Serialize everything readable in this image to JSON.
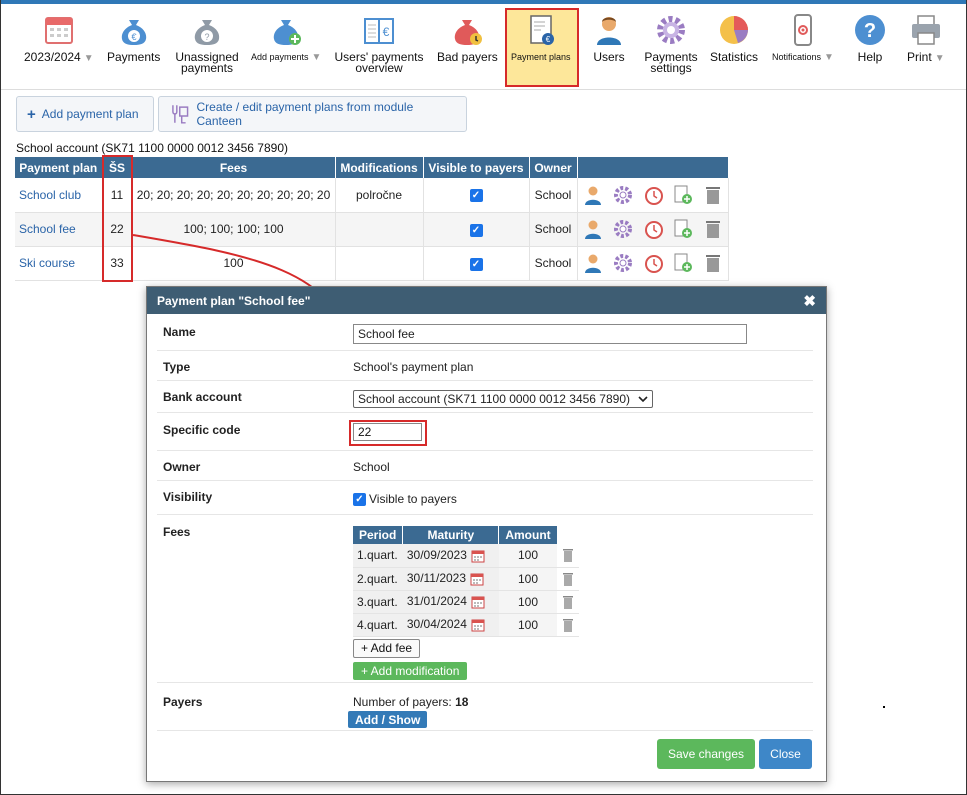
{
  "toolbar": {
    "items": [
      {
        "label": "2023/2024",
        "icon": "calendar-icon",
        "has_dropdown": true
      },
      {
        "label": "Payments",
        "icon": "money-bag-icon",
        "has_dropdown": false
      },
      {
        "label": "Unassigned payments",
        "icon": "unassigned-bag-icon",
        "has_dropdown": false
      },
      {
        "label": "Add payments",
        "icon": "add-payments-icon",
        "has_dropdown": true
      },
      {
        "label": "Users' payments overview",
        "icon": "ledger-icon",
        "has_dropdown": false
      },
      {
        "label": "Bad payers",
        "icon": "bad-payers-icon",
        "has_dropdown": false
      },
      {
        "label": "Payment plans",
        "icon": "payment-plan-document-icon",
        "has_dropdown": false,
        "active": true
      },
      {
        "label": "Users",
        "icon": "user-icon",
        "has_dropdown": false
      },
      {
        "label": "Payments settings",
        "icon": "gear-icon",
        "has_dropdown": false
      },
      {
        "label": "Statistics",
        "icon": "pie-chart-icon",
        "has_dropdown": false
      },
      {
        "label": "Notifications",
        "icon": "phone-icon",
        "has_dropdown": true
      },
      {
        "label": "Help",
        "icon": "help-icon",
        "has_dropdown": false
      },
      {
        "label": "Print",
        "icon": "printer-icon",
        "has_dropdown": true
      }
    ]
  },
  "actions": {
    "add_plan": "Add payment plan",
    "canteen": "Create / edit payment plans from module Canteen"
  },
  "account_label": "School account (SK71 1100 0000 0012 3456 7890)",
  "table": {
    "headers": [
      "Payment plan",
      "ŠS",
      "Fees",
      "Modifications",
      "Visible to payers",
      "Owner"
    ],
    "rows": [
      {
        "name": "School club",
        "ss": "11",
        "fees": "20; 20; 20; 20; 20; 20; 20; 20; 20; 20",
        "modifications": "polročne",
        "visible": true,
        "owner": "School"
      },
      {
        "name": "School fee",
        "ss": "22",
        "fees": "100; 100; 100; 100",
        "modifications": "",
        "visible": true,
        "owner": "School"
      },
      {
        "name": "Ski course",
        "ss": "33",
        "fees": "100",
        "modifications": "",
        "visible": true,
        "owner": "School"
      }
    ]
  },
  "dialog": {
    "title": "Payment plan \"School fee\"",
    "close_glyph": "✖",
    "labels": {
      "name": "Name",
      "type": "Type",
      "bank": "Bank account",
      "specific": "Specific code",
      "owner": "Owner",
      "visibility": "Visibility",
      "fees": "Fees",
      "payers": "Payers"
    },
    "name_value": "School fee",
    "type_value": "School's payment plan",
    "bank_value": "School account (SK71 1100 0000 0012 3456 7890)",
    "specific_value": "22",
    "owner_value": "School",
    "visibility_label": "Visible to payers",
    "visibility_checked": true,
    "fees_headers": [
      "Period",
      "Maturity",
      "Amount"
    ],
    "fees": [
      {
        "period": "1.quart.",
        "maturity": "30/09/2023",
        "amount": "100"
      },
      {
        "period": "2.quart.",
        "maturity": "30/11/2023",
        "amount": "100"
      },
      {
        "period": "3.quart.",
        "maturity": "31/01/2024",
        "amount": "100"
      },
      {
        "period": "4.quart.",
        "maturity": "30/04/2024",
        "amount": "100"
      }
    ],
    "add_fee": "+ Add fee",
    "add_modification": "+ Add modification",
    "payers_prefix": "Number of payers:",
    "payers_count": "18",
    "add_show": "Add / Show",
    "save": "Save changes",
    "close": "Close"
  },
  "colors": {
    "header_blue": "#3b6a92",
    "highlight_red": "#d62a2a",
    "active_tab": "#fde79a",
    "save_green": "#5cb85c",
    "close_blue": "#3e87c8"
  }
}
